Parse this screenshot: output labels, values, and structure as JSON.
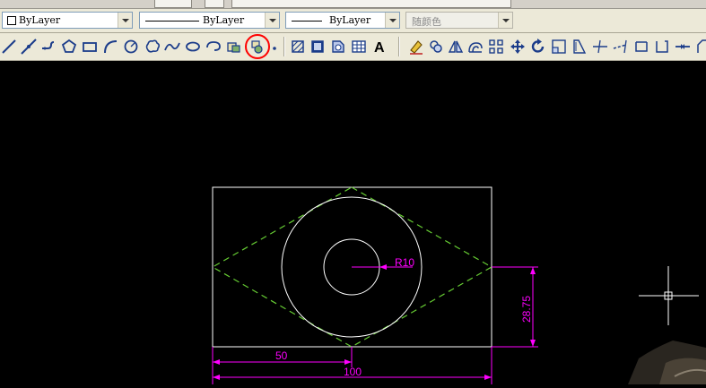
{
  "properties": {
    "color_value": "ByLayer",
    "linetype_value": "ByLayer",
    "lineweight_value": "ByLayer",
    "plotstyle_value": "随颜色"
  },
  "draw_tools": [
    "line-icon",
    "construction-line-icon",
    "polyline-icon",
    "polygon-icon",
    "rectangle-icon",
    "arc-icon",
    "circle-icon",
    "revision-cloud-icon",
    "spline-icon",
    "ellipse-icon",
    "ellipse-arc-icon",
    "insert-block-icon",
    "make-block-icon",
    "point-icon",
    "hatch-icon",
    "gradient-icon",
    "region-icon",
    "table-icon",
    "multiline-text-icon"
  ],
  "modify_tools": [
    "erase-icon",
    "copy-icon",
    "mirror-icon",
    "offset-icon",
    "array-icon",
    "move-icon",
    "rotate-icon",
    "scale-icon",
    "stretch-icon",
    "trim-icon",
    "extend-icon",
    "break-at-point-icon",
    "break-icon",
    "join-icon",
    "chamfer-icon"
  ],
  "drawing": {
    "dimensions": {
      "radius": "R10",
      "width_half": "50",
      "width_full": "100",
      "height": "28.75"
    }
  },
  "colors": {
    "dimension": "#ff00ff",
    "centerline": "#66cc33",
    "geometry": "#ffffff",
    "annotation": "#ff0000"
  }
}
